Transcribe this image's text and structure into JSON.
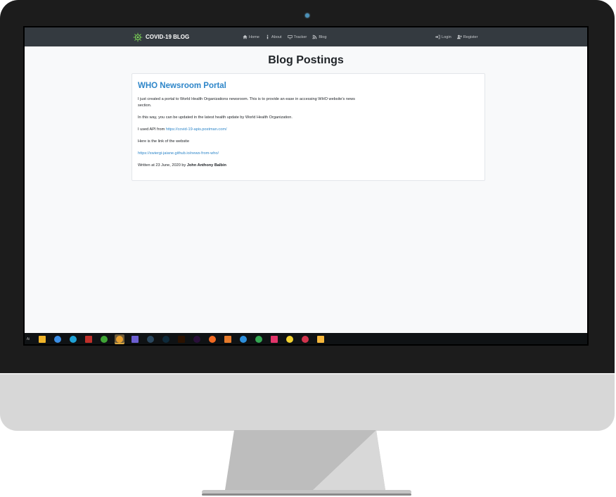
{
  "navbar": {
    "brand": "COVID-19 BLOG",
    "links": [
      {
        "label": "Home",
        "icon": "home-icon"
      },
      {
        "label": "About",
        "icon": "info-icon"
      },
      {
        "label": "Tracker",
        "icon": "monitor-icon"
      },
      {
        "label": "Blog",
        "icon": "blog-icon"
      }
    ],
    "right_links": [
      {
        "label": "Login",
        "icon": "sign-in-icon"
      },
      {
        "label": "Register",
        "icon": "user-plus-icon"
      }
    ]
  },
  "page": {
    "title": "Blog Postings"
  },
  "post": {
    "title": "WHO Newsroom Portal",
    "paragraph_1": "I just created a portal to World Health Organizations newsroom. This is to provide an ease in accessing WHO website's news section.",
    "paragraph_2": "In this way, you can be updated in the latest health update by World Health Organization.",
    "api_prefix": "I used API from",
    "api_link": "https://covid-19-apis.postman.com/",
    "website_intro": "Here is the link of the website",
    "website_link": "https://swiergi-jaiane.github.io/news-from-who/",
    "written_prefix": "Written at 23 June, 2020 by",
    "author": "John Anthony Balbin"
  },
  "taskbar": {
    "search_label": "Ai",
    "apps": [
      {
        "name": "file-explorer-icon",
        "color": "#f0b429"
      },
      {
        "name": "mail-icon",
        "color": "#3a8ee6"
      },
      {
        "name": "edge-icon",
        "color": "#1fa2d6"
      },
      {
        "name": "car-game-icon",
        "color": "#c0302a"
      },
      {
        "name": "xbox-icon",
        "color": "#3fa535"
      },
      {
        "name": "chrome-icon",
        "color": "#e6a030"
      },
      {
        "name": "media-player-icon",
        "color": "#6c5ed1"
      },
      {
        "name": "steam-icon",
        "color": "#2a475e"
      },
      {
        "name": "photoshop-icon",
        "color": "#0e2a3b"
      },
      {
        "name": "illustrator-icon",
        "color": "#2b1200"
      },
      {
        "name": "premiere-icon",
        "color": "#2a0f3a"
      },
      {
        "name": "firefox-icon",
        "color": "#f26a22"
      },
      {
        "name": "photos-icon",
        "color": "#e57a2b"
      },
      {
        "name": "vscode-icon",
        "color": "#2d8fdc"
      },
      {
        "name": "chrome-alt-icon",
        "color": "#34a853"
      },
      {
        "name": "music-icon",
        "color": "#e2356a"
      },
      {
        "name": "sticky-notes-icon",
        "color": "#f3d230"
      },
      {
        "name": "snip-tool-icon",
        "color": "#d2344d"
      },
      {
        "name": "sketch-icon",
        "color": "#f6b73c"
      }
    ]
  }
}
